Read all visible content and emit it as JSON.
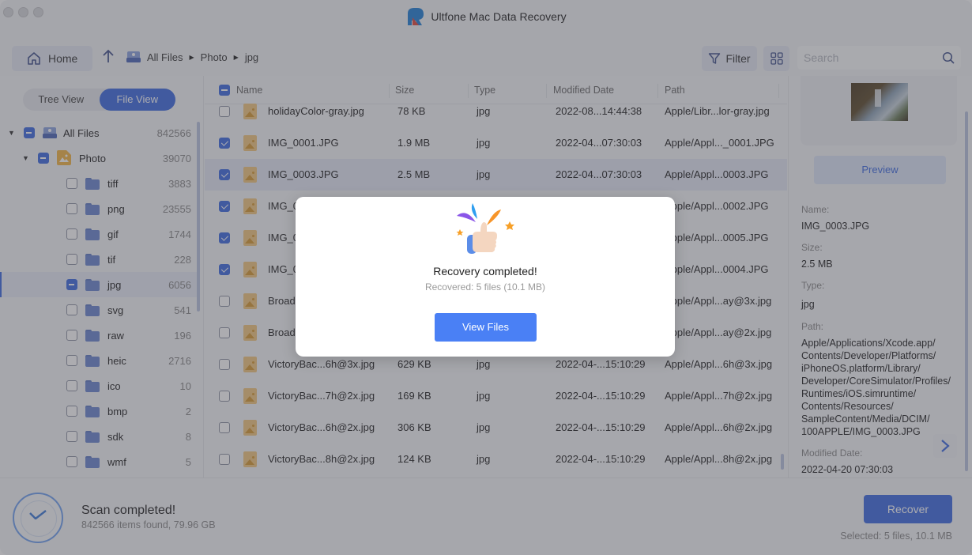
{
  "window": {
    "title": "Ultfone Mac Data Recovery"
  },
  "toolbar": {
    "home_label": "Home",
    "breadcrumb": [
      "All Files",
      "Photo",
      "jpg"
    ],
    "filter_label": "Filter",
    "search_placeholder": "Search",
    "search_value": ""
  },
  "left_panel": {
    "tabs": [
      {
        "label": "Tree View",
        "active": false
      },
      {
        "label": "File View",
        "active": true
      }
    ],
    "tree": [
      {
        "label": "All Files",
        "count": "842566",
        "level": 0,
        "state": "partial",
        "expanded": true,
        "icon": "drive-icon"
      },
      {
        "label": "Photo",
        "count": "39070",
        "level": 1,
        "state": "partial",
        "expanded": true,
        "icon": "photo-folder-icon"
      },
      {
        "label": "tiff",
        "count": "3883",
        "level": 2,
        "state": "unchecked",
        "icon": "folder-icon"
      },
      {
        "label": "png",
        "count": "23555",
        "level": 2,
        "state": "unchecked",
        "icon": "folder-icon"
      },
      {
        "label": "gif",
        "count": "1744",
        "level": 2,
        "state": "unchecked",
        "icon": "folder-icon"
      },
      {
        "label": "tif",
        "count": "228",
        "level": 2,
        "state": "unchecked",
        "icon": "folder-icon"
      },
      {
        "label": "jpg",
        "count": "6056",
        "level": 2,
        "state": "partial",
        "selected": true,
        "icon": "folder-icon"
      },
      {
        "label": "svg",
        "count": "541",
        "level": 2,
        "state": "unchecked",
        "icon": "folder-icon"
      },
      {
        "label": "raw",
        "count": "196",
        "level": 2,
        "state": "unchecked",
        "icon": "folder-icon"
      },
      {
        "label": "heic",
        "count": "2716",
        "level": 2,
        "state": "unchecked",
        "icon": "folder-icon"
      },
      {
        "label": "ico",
        "count": "10",
        "level": 2,
        "state": "unchecked",
        "icon": "folder-icon"
      },
      {
        "label": "bmp",
        "count": "2",
        "level": 2,
        "state": "unchecked",
        "icon": "folder-icon"
      },
      {
        "label": "sdk",
        "count": "8",
        "level": 2,
        "state": "unchecked",
        "icon": "folder-icon"
      },
      {
        "label": "wmf",
        "count": "5",
        "level": 2,
        "state": "unchecked",
        "icon": "folder-icon"
      }
    ]
  },
  "table": {
    "columns": [
      "Name",
      "Size",
      "Type",
      "Modified Date",
      "Path"
    ],
    "rows": [
      {
        "name": "holidayColor-gray.jpg",
        "size": "78 KB",
        "type": "jpg",
        "date": "2022-08...14:44:38",
        "path": "Apple/Libr...lor-gray.jpg",
        "checked": false,
        "selected": false
      },
      {
        "name": "IMG_0001.JPG",
        "size": "1.9 MB",
        "type": "jpg",
        "date": "2022-04...07:30:03",
        "path": "Apple/Appl..._0001.JPG",
        "checked": true,
        "selected": false
      },
      {
        "name": "IMG_0003.JPG",
        "size": "2.5 MB",
        "type": "jpg",
        "date": "2022-04...07:30:03",
        "path": "Apple/Appl...0003.JPG",
        "checked": true,
        "selected": true
      },
      {
        "name": "IMG_0",
        "size": "",
        "type": "",
        "date": "",
        "path": "Apple/Appl...0002.JPG",
        "checked": true,
        "selected": false
      },
      {
        "name": "IMG_0",
        "size": "",
        "type": "",
        "date": "",
        "path": "Apple/Appl...0005.JPG",
        "checked": true,
        "selected": false
      },
      {
        "name": "IMG_0",
        "size": "",
        "type": "",
        "date": "",
        "path": "Apple/Appl...0004.JPG",
        "checked": true,
        "selected": false
      },
      {
        "name": "Broad",
        "size": "",
        "type": "",
        "date": "",
        "path": "Apple/Appl...ay@3x.jpg",
        "checked": false,
        "selected": false
      },
      {
        "name": "Broad",
        "size": "",
        "type": "",
        "date": "",
        "path": "Apple/Appl...ay@2x.jpg",
        "checked": false,
        "selected": false
      },
      {
        "name": "VictoryBac...6h@3x.jpg",
        "size": "629 KB",
        "type": "jpg",
        "date": "2022-04-...15:10:29",
        "path": "Apple/Appl...6h@3x.jpg",
        "checked": false,
        "selected": false
      },
      {
        "name": "VictoryBac...7h@2x.jpg",
        "size": "169 KB",
        "type": "jpg",
        "date": "2022-04-...15:10:29",
        "path": "Apple/Appl...7h@2x.jpg",
        "checked": false,
        "selected": false
      },
      {
        "name": "VictoryBac...6h@2x.jpg",
        "size": "306 KB",
        "type": "jpg",
        "date": "2022-04-...15:10:29",
        "path": "Apple/Appl...6h@2x.jpg",
        "checked": false,
        "selected": false
      },
      {
        "name": "VictoryBac...8h@2x.jpg",
        "size": "124 KB",
        "type": "jpg",
        "date": "2022-04-...15:10:29",
        "path": "Apple/Appl...8h@2x.jpg",
        "checked": false,
        "selected": false
      }
    ]
  },
  "detail": {
    "preview_label": "Preview",
    "fields": [
      {
        "label": "Name:",
        "value": "IMG_0003.JPG"
      },
      {
        "label": "Size:",
        "value": "2.5 MB"
      },
      {
        "label": "Type:",
        "value": "jpg"
      },
      {
        "label": "Path:",
        "value": "Apple/Applications/Xcode.app/\nContents/Developer/Platforms/\niPhoneOS.platform/Library/\nDeveloper/CoreSimulator/Profiles/\nRuntimes/iOS.simruntime/\nContents/Resources/\nSampleContent/Media/DCIM/\n100APPLE/IMG_0003.JPG"
      },
      {
        "label": "Modified Date:",
        "value": "2022-04-20 07:30:03"
      }
    ]
  },
  "status": {
    "title": "Scan completed!",
    "subtitle": "842566 items found, 79.96 GB",
    "recover_label": "Recover",
    "selected_info": "Selected: 5 files, 10.1 MB"
  },
  "modal": {
    "title": "Recovery completed!",
    "subtitle": "Recovered: 5 files (10.1 MB)",
    "button_label": "View Files"
  },
  "colors": {
    "accent": "#3d6be0",
    "modal_button": "#4a80f5",
    "photo_icon": "#f2c77f"
  }
}
